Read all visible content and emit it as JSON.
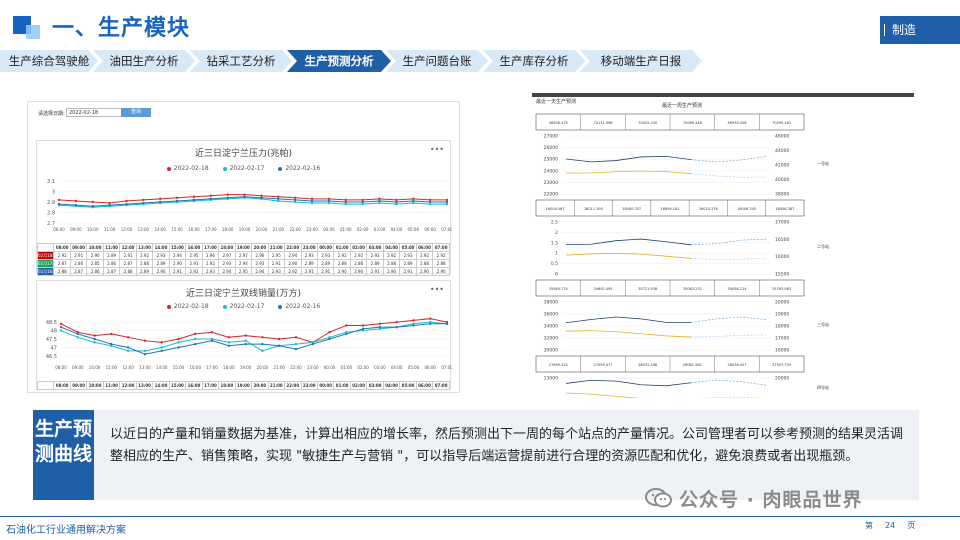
{
  "header": {
    "title": "一、生产模块",
    "right_label": "制造"
  },
  "tabs": [
    {
      "label": "生产综合驾驶舱",
      "active": false
    },
    {
      "label": "油田生产分析",
      "active": false
    },
    {
      "label": "钻采工艺分析",
      "active": false
    },
    {
      "label": "生产预测分析",
      "active": true
    },
    {
      "label": "生产问题台账",
      "active": false
    },
    {
      "label": "生产库存分析",
      "active": false
    },
    {
      "label": "移动端生产日报",
      "active": false
    }
  ],
  "left_screen": {
    "filter_label": "请选择日期:",
    "date_value": "2022-02-18",
    "query_button": "查询",
    "legend": [
      {
        "name": "2022-02-18",
        "color": "#d62728"
      },
      {
        "name": "2022-02-17",
        "color": "#17becf"
      },
      {
        "name": "2022-02-16",
        "color": "#1f77b4"
      }
    ],
    "times": [
      "08:00",
      "09:00",
      "10:00",
      "11:00",
      "12:00",
      "13:00",
      "14:00",
      "15:00",
      "16:00",
      "17:00",
      "18:00",
      "19:00",
      "20:00",
      "21:00",
      "22:00",
      "23:00",
      "00:00",
      "01:00",
      "02:00",
      "03:00",
      "04:00",
      "05:00",
      "06:00",
      "07:00"
    ],
    "pressure_chart": {
      "title": "近三日淀宁兰压力(兆帕)",
      "yticks": [
        "3.1",
        "3",
        "2.9",
        "2.8",
        "2.7"
      ],
      "ylim": [
        2.7,
        3.1
      ],
      "row_header": "字段名",
      "rows": [
        {
          "label": "02月18日",
          "values": [
            "2.92",
            "2.91",
            "2.90",
            "2.89",
            "2.91",
            "2.92",
            "2.93",
            "2.94",
            "2.95",
            "2.96",
            "2.97",
            "2.97",
            "2.96",
            "2.95",
            "2.94",
            "2.93",
            "2.93",
            "2.92",
            "2.92",
            "2.93",
            "2.92",
            "2.93",
            "2.92",
            "2.92"
          ]
        },
        {
          "label": "02月17日",
          "values": [
            "2.87",
            "2.86",
            "2.85",
            "2.86",
            "2.87",
            "2.88",
            "2.89",
            "2.90",
            "2.91",
            "2.92",
            "2.93",
            "2.94",
            "2.93",
            "2.91",
            "2.90",
            "2.89",
            "2.89",
            "2.88",
            "2.88",
            "2.89",
            "2.88",
            "2.89",
            "2.88",
            "2.88"
          ]
        },
        {
          "label": "02月16日",
          "values": [
            "2.88",
            "2.87",
            "2.86",
            "2.87",
            "2.88",
            "2.89",
            "2.90",
            "2.91",
            "2.92",
            "2.93",
            "2.94",
            "2.95",
            "2.94",
            "2.93",
            "2.92",
            "2.91",
            "2.91",
            "2.90",
            "2.90",
            "2.91",
            "2.90",
            "2.91",
            "2.90",
            "2.90"
          ]
        }
      ]
    },
    "sales_chart": {
      "title": "近三日淀宁兰双线销量(万方)",
      "yticks": [
        "48.5",
        "48",
        "47.5",
        "47",
        "46.5"
      ],
      "ylim": [
        46.2,
        48.8
      ],
      "row_header": "字段名",
      "series": [
        {
          "name": "2022-02-18",
          "values": [
            48.4,
            47.9,
            47.7,
            47.8,
            47.6,
            47.4,
            47.3,
            47.5,
            47.8,
            47.9,
            47.6,
            47.7,
            47.6,
            47.5,
            47.6,
            47.3,
            47.9,
            48.3,
            48.3,
            48.4,
            48.5,
            48.6,
            48.7,
            48.5
          ]
        },
        {
          "name": "2022-02-17",
          "values": [
            48.0,
            47.6,
            47.3,
            47.1,
            46.8,
            46.8,
            47.0,
            47.3,
            47.5,
            47.5,
            47.3,
            47.4,
            46.8,
            47.1,
            47.2,
            47.3,
            47.6,
            47.9,
            48.0,
            48.1,
            48.2,
            48.4,
            48.5,
            48.4
          ]
        },
        {
          "name": "2022-02-16",
          "values": [
            48.2,
            47.8,
            47.5,
            47.2,
            47.0,
            46.6,
            46.8,
            47.0,
            47.2,
            47.4,
            47.1,
            47.2,
            47.2,
            47.1,
            46.9,
            47.2,
            47.5,
            47.8,
            48.1,
            48.2,
            48.2,
            48.3,
            48.4,
            48.4
          ]
        }
      ]
    }
  },
  "right_screen": {
    "header_left": "最近一天生产预测",
    "header_mid": "最近一周生产预测",
    "sections": [
      {
        "label": "一号站",
        "values": [
          "46926.475",
          "70131.998",
          "70002.200",
          "70069.446",
          "46935.456",
          "70095.161"
        ],
        "y_left": [
          "27000",
          "26000",
          "25000",
          "24000",
          "23000",
          "22000"
        ],
        "y_right": [
          "46000",
          "44000",
          "42000",
          "40000",
          "38000"
        ]
      },
      {
        "label": "二号站",
        "values": [
          "16004.067",
          "16011.395",
          "16400.357",
          "16894.161",
          "16015.376",
          "16006.345",
          "16006.387"
        ],
        "y_left": [
          "2.5",
          "2",
          "1.5",
          "1",
          "0.5",
          "0"
        ],
        "y_right": [
          "17000",
          "16500",
          "16000",
          "15500"
        ]
      },
      {
        "label": "三号站",
        "values": [
          "35940.774",
          "34692.495",
          "35721.938",
          "35063.232",
          "34056.214",
          "35763.963"
        ],
        "y_left": [
          "38000",
          "36000",
          "34000",
          "32000",
          "30000"
        ],
        "y_right": [
          "20000",
          "19000",
          "18000",
          "17000",
          "16000"
        ]
      },
      {
        "label": "四号站",
        "values": [
          "27699.424",
          "27095.477",
          "26031.298",
          "26061.562",
          "26036.407",
          "27597.709"
        ],
        "y_left": [
          "13000",
          "12000"
        ],
        "y_right": [
          "20000",
          "18000"
        ]
      }
    ]
  },
  "description": {
    "tag": "生产预测曲线",
    "text": "以近日的产量和销量数据为基准，计算出相应的增长率，然后预测出下一周的每个站点的产量情况。公司管理者可以参考预测的结果灵活调整相应的生产、销售策略，实现 \"敏捷生产与营销 \"，可以指导后端运营提前进行合理的资源匹配和优化，避免浪费或者出现瓶颈。"
  },
  "watermark": "公众号 · 肉眼品世界",
  "footer": {
    "left": "石油化工行业通用解决方案",
    "page_prefix": "第",
    "page_number": "24",
    "page_suffix": "页"
  },
  "colors": {
    "brand": "#1f5fa8",
    "accent_light": "#d7e8f7"
  }
}
